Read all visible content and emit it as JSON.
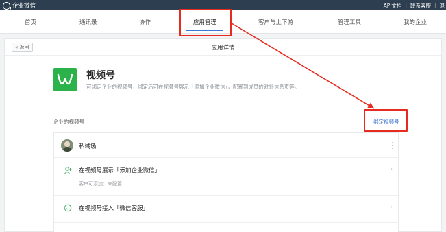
{
  "topbar": {
    "brand": "企业微信",
    "links": [
      "API文档",
      "联系客服",
      "退"
    ]
  },
  "nav": {
    "items": [
      "首页",
      "通讯录",
      "协作",
      "应用管理",
      "客户与上下游",
      "管理工具",
      "我的企业"
    ],
    "active_index": 3
  },
  "panel": {
    "back_label": "« 返回",
    "title": "应用详情"
  },
  "app": {
    "name": "视频号",
    "description": "可绑定企业的视频号，绑定后可在视频号展示「添加企业微信」，配置到成员的对外信息页等。"
  },
  "section": {
    "label": "企业的视频号",
    "bind_link": "绑定视频号"
  },
  "list": {
    "account_name": "私域场",
    "row2_title": "在视频号展示「添加企业微信」",
    "row2_sub": "客户可添加：未配置",
    "row3_title": "在视频号接入「微信客服」"
  },
  "colors": {
    "topbar": "#2d3e50",
    "accent": "#3b7ad8",
    "brand_green": "#2cb24a",
    "annotation": "#e62b20"
  },
  "icons": {
    "brand": "search-chat-logo",
    "app": "video-channel-logo",
    "row2": "add-contact-icon",
    "row3": "customer-service-icon",
    "more": "more-icon",
    "chevron": "chevron-right-icon"
  }
}
